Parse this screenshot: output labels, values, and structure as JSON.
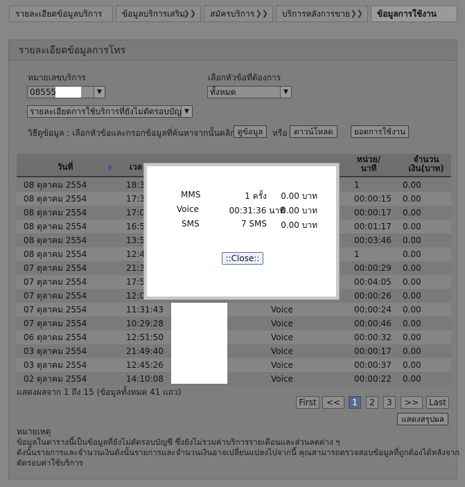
{
  "tabs": [
    {
      "label": "รายละเอียดข้อมูลบริการ"
    },
    {
      "label": "ข้อมูลบริการเสริม"
    },
    {
      "label": "สมัครบริการ"
    },
    {
      "label": "บริการหลังการขาย"
    },
    {
      "label": "ข้อมูลการใช้งาน"
    }
  ],
  "panel": {
    "title": "รายละเอียดข้อมูลการโทร"
  },
  "form": {
    "number_label": "หมายเลขบริการ",
    "number_value": "08555",
    "topic_label": "เลือกหัวข้อที่ต้องการ",
    "topic_value": "ทั้งหมด",
    "detail_value": "รายละเอียดการใช้บริการที่ยังไม่ตัดรอบบัญชี",
    "howto_text": "วิธีดูข้อมูล : เลือกหัวข้อและกรอกข้อมูลที่ค้นหาจากนั้นคลิกปุ่ม",
    "view_btn": "ดูข้อมูล",
    "or_text": "หรือ",
    "download_btn": "ดาวน์โหลด",
    "usage_btn": "ยอดการใช้งาน"
  },
  "table": {
    "headers": {
      "date": "วันที่",
      "time": "เวล",
      "unit": "หน่วย/ นาที",
      "amount": "จำนวน เงิน(บาท)",
      "sort_icon": "▼"
    },
    "rows": [
      {
        "date": "08 ตุลาคม 2554",
        "time": "18:31",
        "type": "",
        "unit": "1",
        "amount": "0.00"
      },
      {
        "date": "08 ตุลาคม 2554",
        "time": "17:30",
        "type": "",
        "unit": "00:00:15",
        "amount": "0.00"
      },
      {
        "date": "08 ตุลาคม 2554",
        "time": "17:05",
        "type": "",
        "unit": "00:00:17",
        "amount": "0.00"
      },
      {
        "date": "08 ตุลาคม 2554",
        "time": "16:57",
        "type": "",
        "unit": "00:01:17",
        "amount": "0.00"
      },
      {
        "date": "08 ตุลาคม 2554",
        "time": "13:57",
        "type": "",
        "unit": "00:03:46",
        "amount": "0.00"
      },
      {
        "date": "08 ตุลาคม 2554",
        "time": "12:46",
        "type": "",
        "unit": "1",
        "amount": "0.00"
      },
      {
        "date": "07 ตุลาคม 2554",
        "time": "21:37",
        "type": "",
        "unit": "00:00:29",
        "amount": "0.00"
      },
      {
        "date": "07 ตุลาคม 2554",
        "time": "17:58",
        "type": "",
        "unit": "00:04:05",
        "amount": "0.00"
      },
      {
        "date": "07 ตุลาคม 2554",
        "time": "12:08",
        "type": "",
        "unit": "00:00:26",
        "amount": "0.00"
      },
      {
        "date": "07 ตุลาคม 2554",
        "time": "11:31:43",
        "type": "Voice",
        "unit": "00:00:24",
        "amount": "0.00"
      },
      {
        "date": "07 ตุลาคม 2554",
        "time": "10:29:28",
        "type": "Voice",
        "unit": "00:00:46",
        "amount": "0.00"
      },
      {
        "date": "06 ตุลาคม 2554",
        "time": "12:51:50",
        "type": "Voice",
        "unit": "00:00:32",
        "amount": "0.00"
      },
      {
        "date": "03 ตุลาคม 2554",
        "time": "21:49:40",
        "type": "Voice",
        "unit": "00:00:17",
        "amount": "0.00"
      },
      {
        "date": "03 ตุลาคม 2554",
        "time": "12:45:26",
        "type": "Voice",
        "unit": "00:00:37",
        "amount": "0.00"
      },
      {
        "date": "02 ตุลาคม 2554",
        "time": "14:10:08",
        "type": "Voice",
        "unit": "00:00:22",
        "amount": "0.00"
      }
    ],
    "summary": "แสดงผลจาก 1 ถึง 15 (ข้อมูลทั้งหมด 41 แถว)"
  },
  "pager": {
    "first": "First",
    "prev": "<<",
    "pages": [
      "1",
      "2",
      "3"
    ],
    "next": ">>",
    "last": "Last",
    "summary_btn": "แสดงสรุปผล"
  },
  "note": {
    "title": "หมายเหตุ",
    "line1": "ข้อมูลในตารางนี้เป็นข้อมูลที่ยังไม่ตัดรอบบัญชี ซึ่งยังไม่รวมค่าบริการรายเดือนและส่วนลดต่าง ๆ",
    "line2": "ดังนั้นรายการและจำนวนเงินดังนั้นรายการและจำนวนเงินอาจเปลี่ยนแปลงไปจากนี้ คุณสามารถตรวจสอบข้อมูลที่ถูกต้องได้หลังจาก",
    "line3": "ตัดรอบค่าใช้บริการ"
  },
  "modal": {
    "rows": [
      {
        "label": "MMS",
        "qty": "1 ครั้ง",
        "price": "0.00 บาท"
      },
      {
        "label": "Voice",
        "qty": "00:31:36 นาที",
        "price": "0.00 บาท"
      },
      {
        "label": "SMS",
        "qty": "7 SMS",
        "price": "0.00 บาท"
      }
    ],
    "close_btn": "::Close::"
  }
}
